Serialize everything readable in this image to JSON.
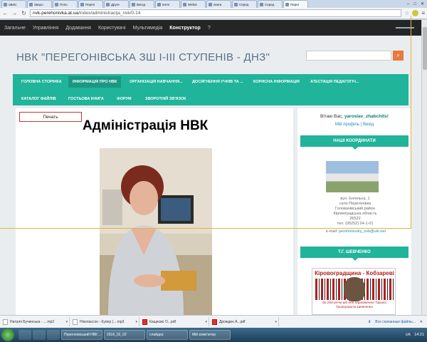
{
  "browser": {
    "tabs": [
      {
        "label": "uBetc",
        "active": false
      },
      {
        "label": "Зворо",
        "active": false
      },
      {
        "label": "Попо",
        "active": false
      },
      {
        "label": "Переп",
        "active": false
      },
      {
        "label": "Друге",
        "active": false
      },
      {
        "label": "Вигод",
        "active": false
      },
      {
        "label": "termi",
        "active": false
      },
      {
        "label": "Webst",
        "active": false
      },
      {
        "label": "книги",
        "active": false
      },
      {
        "label": "Серед",
        "active": false
      },
      {
        "label": "Серед",
        "active": false
      },
      {
        "label": "Перег",
        "active": true
      }
    ],
    "url_domain": "nvk-perehonivka.at.ua",
    "url_path": "/index/administracija_nvk/0-14"
  },
  "adminbar": {
    "items": [
      "Загальне",
      "Управління",
      "Додавання",
      "Користувачі",
      "Мультимедіа",
      "Конструктор",
      "?"
    ]
  },
  "site": {
    "title": "НВК \"ПЕРЕГОНІВСЬКА ЗШ І-ІІІ СТУПЕНІВ - ДНЗ\"",
    "nav": [
      "ГОЛОВНА СТОРІНКА",
      "ІНФОРМАЦІЯ ПРО НВК",
      "ОРГАНІЗАЦІЯ НАВЧАННЯ...",
      "ДОСЯГНЕННЯ УЧНІВ ТА ...",
      "КОРИСНА ІНФОРМАЦІЯ",
      "АТЕСТАЦІЯ ПЕДАГОГІЧ...",
      "КАТАЛОГ ФАЙЛІВ",
      "ГОСТЬОВА КНИГА",
      "ФОРУМ",
      "ЗВОРОТНІЙ ЗВ'ЯЗОК"
    ]
  },
  "content": {
    "print_label": "Печать",
    "heading": "Адміністрація НВК"
  },
  "sidebar": {
    "greeting": "Вітаю Вас,",
    "username": "yaroslav_zhabchits!",
    "profile_link": "Мій профіль",
    "logout_link": "Вихід",
    "coords_title": "НАШІ КООРДИНАТИ",
    "address_lines": [
      "вул. Енгельса, 1",
      "село Перегонівка",
      "Голованівський район",
      "Кіровоградська область",
      "26522",
      "тел. (05252) 24-1-01"
    ],
    "email_label": "e-mail:",
    "email": "perehonivsky_nvk@ukr.net",
    "shevchenko_title": "Т.Г. ШЕВЧЕНКО",
    "poster_title": "Кіровоградщина - Кобзареві",
    "poster_caption": "до 200-річчя від дня народження Тараса Григоровича Шевченка"
  },
  "downloads": {
    "items": [
      {
        "name": "Наталя Бучинська - ....mp3",
        "type": "audio"
      },
      {
        "name": "Ніколаєсон - Купер (....mp3",
        "type": "audio"
      },
      {
        "name": "Кащеєво О...pdf",
        "type": "pdf"
      },
      {
        "name": "Дрождин А...pdf",
        "type": "pdf"
      }
    ],
    "show_all": "Все скачанные файлы..."
  },
  "taskbar": {
    "windows": [
      "Перегонівський НВК ...",
      "2016_02_02",
      "слайдер",
      "Мій комп'ютер"
    ],
    "lang": "UK",
    "time": "14:21"
  },
  "colors": {
    "accent": "#20b49a",
    "search_button": "#e87a3b",
    "adminbar": "#232527"
  }
}
